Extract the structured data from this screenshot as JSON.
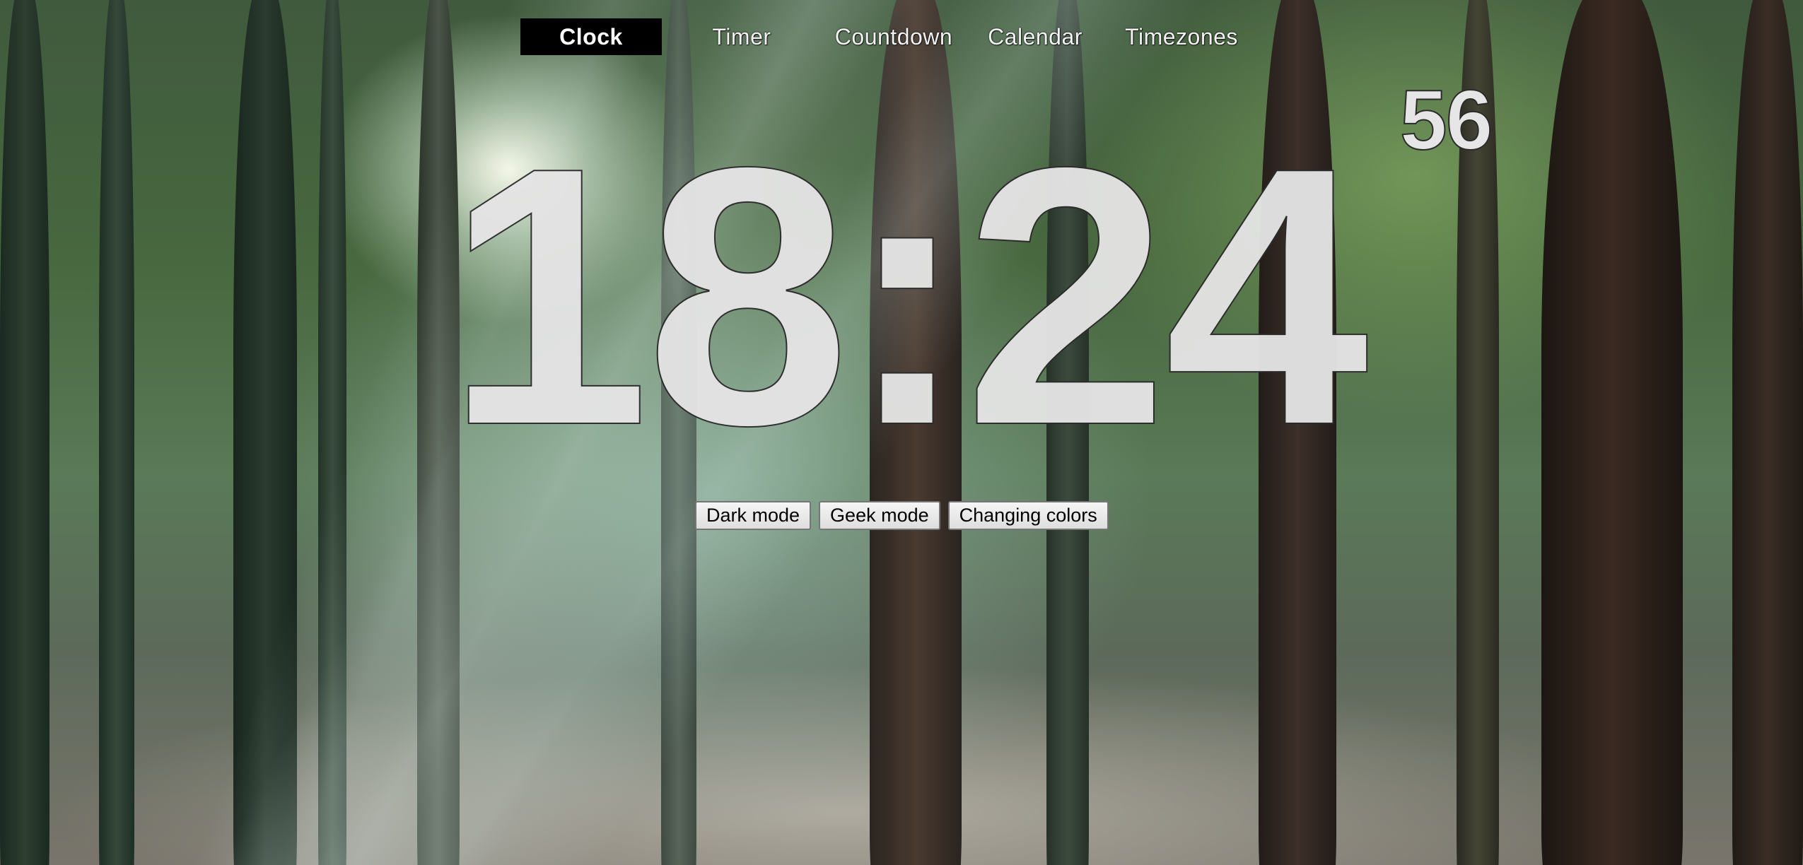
{
  "nav": {
    "items": [
      {
        "label": "Clock",
        "active": true
      },
      {
        "label": "Timer",
        "active": false
      },
      {
        "label": "Countdown",
        "active": false
      },
      {
        "label": "Calendar",
        "active": false
      },
      {
        "label": "Timezones",
        "active": false
      }
    ]
  },
  "clock": {
    "time": "18:24",
    "seconds": "56"
  },
  "buttons": {
    "dark_mode": "Dark mode",
    "geek_mode": "Geek mode",
    "changing_colors": "Changing colors"
  },
  "colors": {
    "digits": "#e4e4e4",
    "digit_outline": "#2b2b2b",
    "active_tab_bg": "#000000"
  }
}
